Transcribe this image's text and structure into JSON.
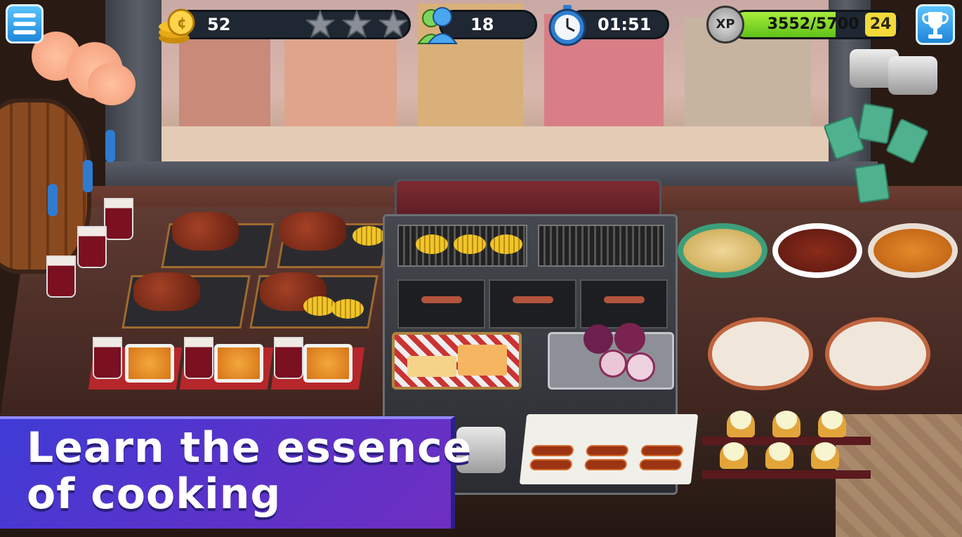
{
  "hud": {
    "coins": "52",
    "stars_earned": 0,
    "stars_total": 3,
    "customers": "18",
    "timer": "01:51",
    "xp_label": "XP",
    "xp_value": "3552/5700",
    "xp_progress": 0.623,
    "level": "24"
  },
  "icons": {
    "menu": "menu-icon",
    "coin": "coin-stack-icon",
    "star": "star-icon",
    "customers": "people-icon",
    "timer": "clock-icon",
    "xp": "xp-badge-icon",
    "trophy": "trophy-icon"
  },
  "banner": {
    "line1": "Learn the essence",
    "line2": "of cooking"
  },
  "colors": {
    "banner_bg": "#4a36d0",
    "xp_fill": "#7fd62a",
    "hud_pill": "#1f2733",
    "button_blue": "#2b95e6"
  }
}
